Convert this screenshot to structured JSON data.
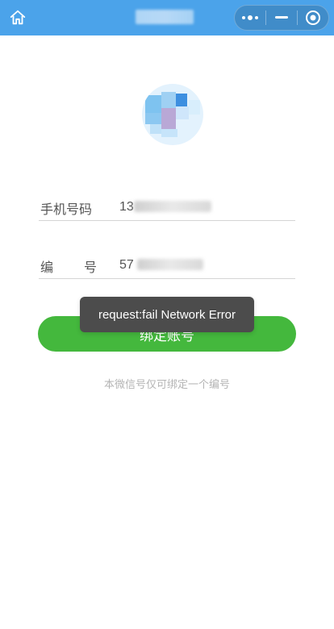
{
  "nav": {
    "home_icon": "home-icon",
    "title": "",
    "capsule": {
      "more_icon": "more-dots-icon",
      "minimize_icon": "minimize-icon",
      "close_icon": "target-close-icon"
    }
  },
  "form": {
    "phone_label": "手机号码",
    "phone_value": "13",
    "code_label_left": "编",
    "code_label_right": "号",
    "code_value": "57"
  },
  "bind_button_label": "绑定账号",
  "hint": "本微信号仅可绑定一个编号",
  "toast": "request:fail Network Error",
  "colors": {
    "topbar": "#4ba3ea",
    "button": "#44b83d",
    "toast_bg": "#4c4c4c"
  }
}
